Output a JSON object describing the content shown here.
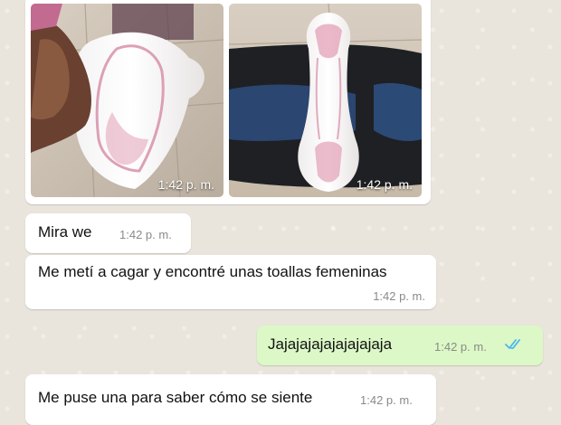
{
  "theme": {
    "wallpaper": "#e9e4dc",
    "incoming_bubble": "#ffffff",
    "outgoing_bubble": "#dcf8c6",
    "read_tick": "#4fb6ec"
  },
  "photo_message": {
    "photos": [
      {
        "time": "1:42 p. m.",
        "subject": "sanitary pad held in hand over tiled floor"
      },
      {
        "time": "1:42 p. m.",
        "subject": "sanitary pad on dark fabric"
      }
    ]
  },
  "messages": [
    {
      "direction": "incoming",
      "text": "Mira we",
      "time": "1:42 p. m."
    },
    {
      "direction": "incoming",
      "text": "Me metí a cagar y encontré unas toallas femeninas",
      "time": "1:42 p. m."
    },
    {
      "direction": "outgoing",
      "text": "Jajajajajajajajajaja",
      "time": "1:42 p. m.",
      "status_icon": "double-check-read-icon"
    },
    {
      "direction": "incoming",
      "text": "Me puse una para saber cómo se siente",
      "time": "1:42 p. m."
    }
  ]
}
